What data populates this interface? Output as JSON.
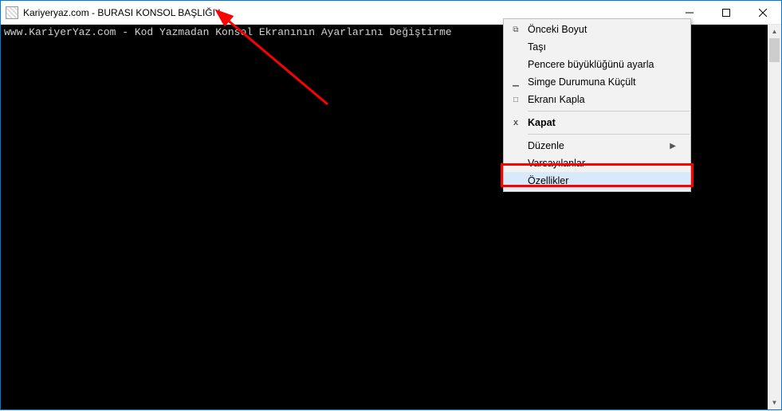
{
  "window": {
    "title": "Kariyeryaz.com - BURASI KONSOL BAŞLIĞI !"
  },
  "console": {
    "line1": "www.KariyerYaz.com - Kod Yazmadan Konsol Ekranının Ayarlarını Değiştirme"
  },
  "menu": {
    "restore": "Önceki Boyut",
    "move": "Taşı",
    "size": "Pencere büyüklüğünü ayarla",
    "minimize": "Simge Durumuna Küçült",
    "maximize": "Ekranı Kapla",
    "close": "Kapat",
    "edit": "Düzenle",
    "defaults": "Varsayılanlar",
    "properties": "Özellikler"
  }
}
